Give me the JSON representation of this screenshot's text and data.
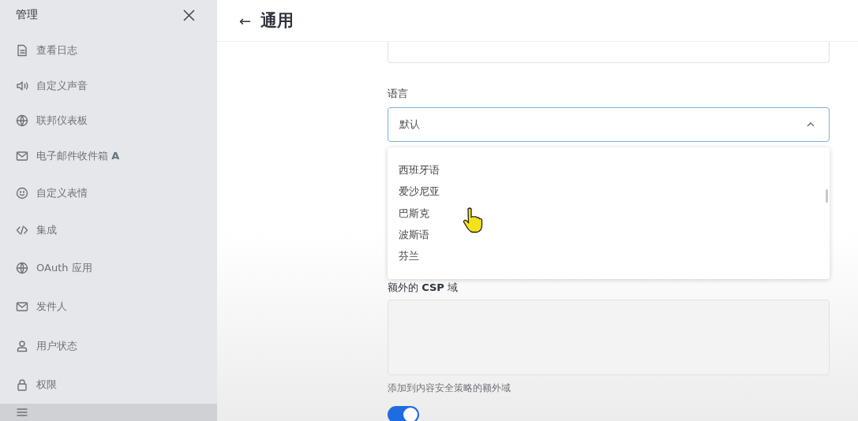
{
  "sidebar": {
    "title": "管理",
    "items": [
      {
        "label": "查看日志",
        "selected": false
      },
      {
        "label": "自定义声音",
        "selected": false
      },
      {
        "label": "联邦仪表板",
        "selected": false
      },
      {
        "label": "电子邮件收件箱 **A**",
        "selected": false
      },
      {
        "label": "自定义表情",
        "selected": false
      },
      {
        "label": "集成",
        "selected": false
      },
      {
        "label": "OAuth 应用",
        "selected": false
      },
      {
        "label": "发件人",
        "selected": false
      },
      {
        "label": "用户状态",
        "selected": false
      },
      {
        "label": "权限",
        "selected": false
      },
      {
        "selected": true
      }
    ]
  },
  "header": {
    "back": "←",
    "title": "通用"
  },
  "language": {
    "label": "语言",
    "value": "默认",
    "expanded": true,
    "options": [
      {
        "label": "西班牙语"
      },
      {
        "label": "爱沙尼亚"
      },
      {
        "label": "巴斯克"
      },
      {
        "label": "波斯语"
      },
      {
        "label": "芬兰"
      }
    ]
  },
  "csp": {
    "label": "额外的 **CSP** 域",
    "help": "添加到内容安全策略的额外域"
  },
  "restrict_toggle": {
    "on": true
  }
}
